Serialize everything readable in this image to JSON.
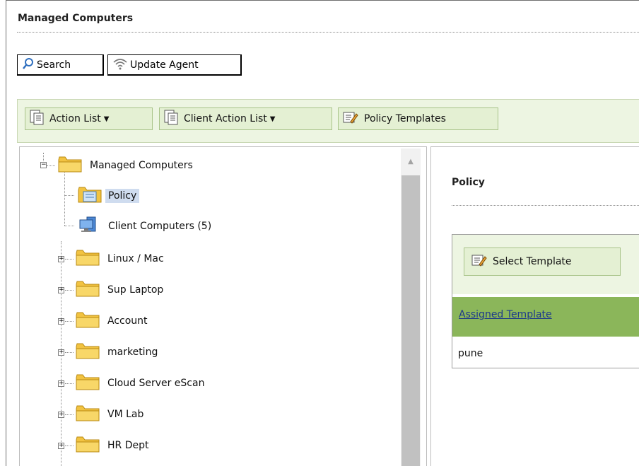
{
  "page": {
    "title": "Managed Computers"
  },
  "top_buttons": {
    "search": "Search",
    "update_agent": "Update Agent"
  },
  "toolbar": {
    "action_list": "Action List",
    "client_action_list": "Client Action List",
    "policy_templates": "Policy Templates"
  },
  "tree": {
    "root": "Managed Computers",
    "policy": "Policy",
    "client_computers": "Client Computers (5)",
    "groups": [
      "Linux / Mac",
      "Sup Laptop",
      "Account",
      "marketing",
      "Cloud Server eScan",
      "VM Lab",
      "HR Dept"
    ]
  },
  "policy_panel": {
    "title": "Policy",
    "select_template": "Select Template",
    "column_header": "Assigned Template",
    "assigned_value": "pune"
  },
  "colors": {
    "toolbar_bg": "#edf5e2",
    "button_bg": "#e4f0d3",
    "header_green": "#8bb65a",
    "selected_bg": "#cfdcef",
    "folder_yellow": "#f2c341"
  }
}
